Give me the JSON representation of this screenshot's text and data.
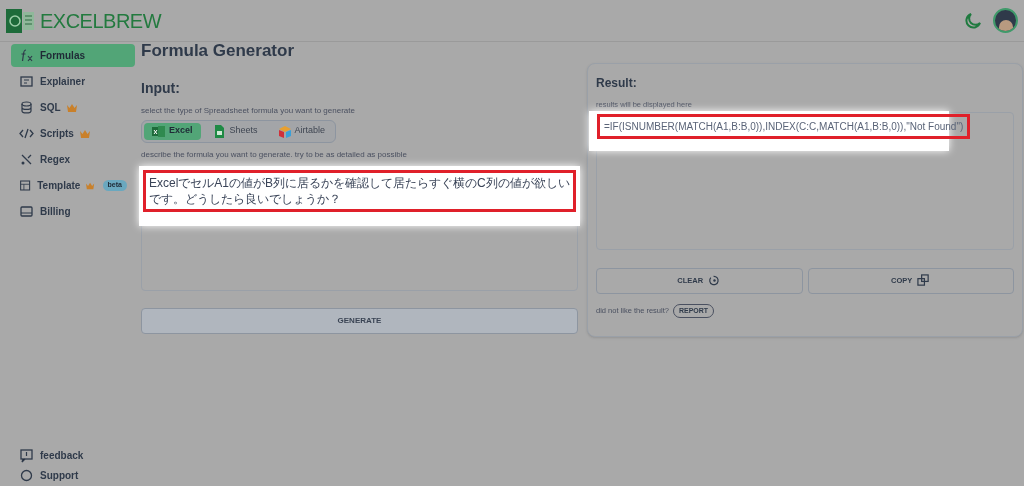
{
  "header": {
    "logo": "EXCELBREW"
  },
  "sidebar": {
    "items": [
      {
        "label": "Formulas",
        "selected": true,
        "premium": false
      },
      {
        "label": "Explainer",
        "selected": false,
        "premium": false
      },
      {
        "label": "SQL",
        "selected": false,
        "premium": true
      },
      {
        "label": "Scripts",
        "selected": false,
        "premium": true
      },
      {
        "label": "Regex",
        "selected": false,
        "premium": false
      },
      {
        "label": "Template",
        "selected": false,
        "premium": true,
        "badge": "beta"
      },
      {
        "label": "Billing",
        "selected": false,
        "premium": false
      }
    ],
    "footer_items": [
      {
        "label": "feedback"
      },
      {
        "label": "Support"
      }
    ]
  },
  "page_title": "Formula Generator",
  "input": {
    "heading": "Input:",
    "type_hint": "select the type of Spreadsheet formula you want to generate",
    "types": [
      {
        "label": "Excel",
        "selected": true
      },
      {
        "label": "Sheets",
        "selected": false
      },
      {
        "label": "Airtable",
        "selected": false
      }
    ],
    "describe_hint": "describe the formula you want to generate. try to be as detailed as possible",
    "prompt": "ExcelでセルA1の値がB列に居るかを確認して居たらすぐ横のC列の値が欲しいです。どうしたら良いでしょうか？",
    "generate_button": "GENERATE"
  },
  "result": {
    "heading": "Result:",
    "hint": "results will be displayed here",
    "value": "=IF(ISNUMBER(MATCH(A1,B:B,0)),INDEX(C:C,MATCH(A1,B:B,0)),\"Not Found\")",
    "buttons": [
      {
        "label": "CLEAR"
      },
      {
        "label": "COPY"
      }
    ],
    "report_text": "did not like the result?",
    "report_button": "REPORT"
  }
}
